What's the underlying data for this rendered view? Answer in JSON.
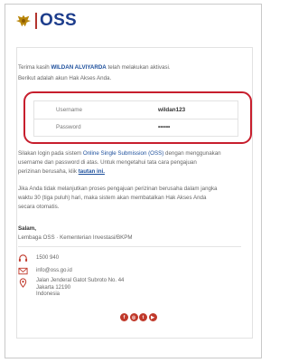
{
  "header": {
    "logo_text": "OSS"
  },
  "greeting": {
    "prefix": "Terima kasih ",
    "name": "WILDAN ALVIYARDA",
    "suffix": " telah melakukan aktivasi.",
    "line2": "Berikut adalah akun Hak Akses Anda."
  },
  "account": {
    "username_label": "Username",
    "username_value": "wildan123",
    "password_label": "Password",
    "password_value": "••••••"
  },
  "body": {
    "p1_a": "Silakan login pada sistem ",
    "p1_link": "Online Single Submission (OSS)",
    "p1_b": " dengan menggunakan",
    "p1_l2": "username dan password di atas. Untuk mengetahui tata cara pengajuan",
    "p1_l3a": "perizinan berusaha, klik ",
    "p1_l3link": "tautan ini.",
    "p2_l1": "Jika Anda tidak melanjutkan proses pengajuan perizinan berusaha dalam jangka",
    "p2_l2": "waktu 30 (tiga puluh) hari, maka sistem akan membatalkan Hak Akses Anda",
    "p2_l3": "secara otomatis.",
    "closing": "Salam,",
    "signature": "Lembaga OSS · Kementerian Investasi/BKPM"
  },
  "contact": {
    "phone": "1500 940",
    "email": "info@oss.go.id",
    "address_l1": "Jalan Jenderal Gatot Subroto No. 44",
    "address_l2": "Jakarta 12190",
    "address_l3": "Indonesia"
  },
  "social": {
    "icons": [
      "facebook",
      "instagram",
      "twitter",
      "youtube"
    ],
    "color": "#c0392b"
  },
  "colors": {
    "accent_red": "#c71e2d",
    "brand_blue": "#1d3d8c"
  }
}
